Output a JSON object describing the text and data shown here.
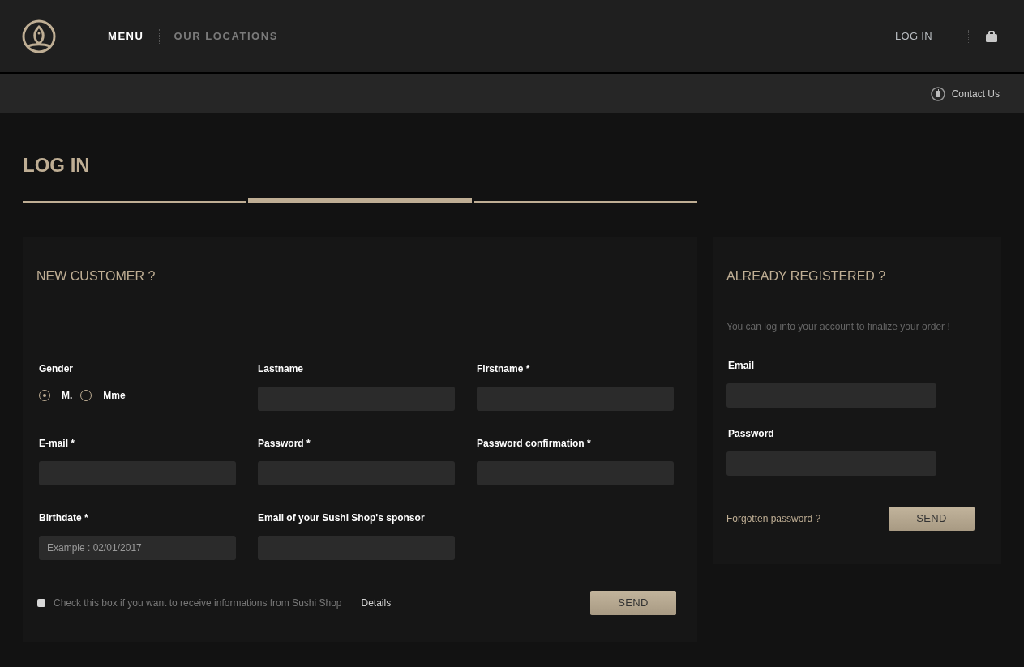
{
  "nav": {
    "items": [
      {
        "label": "MENU",
        "selected": true
      },
      {
        "label": "OUR LOCATIONS",
        "selected": false
      }
    ],
    "login": "LOG IN"
  },
  "subbar": {
    "contact": "Contact Us"
  },
  "page_title": "LOG IN",
  "steps": [
    {
      "selected": false
    },
    {
      "selected": true
    },
    {
      "selected": false
    }
  ],
  "new_customer": {
    "title": "NEW CUSTOMER ?",
    "fields": [
      {
        "kind": "radio",
        "label": "Gender",
        "options": [
          {
            "label": "M.",
            "selected": true
          },
          {
            "label": "Mme",
            "selected": false
          }
        ]
      },
      {
        "kind": "input",
        "label": "Lastname"
      },
      {
        "kind": "input",
        "label": "Firstname *"
      },
      {
        "kind": "input",
        "label": "E-mail *"
      },
      {
        "kind": "input",
        "label": "Password *"
      },
      {
        "kind": "input",
        "label": "Password confirmation *"
      },
      {
        "kind": "input",
        "label": "Birthdate *",
        "placeholder": "Example : 02/01/2017"
      },
      {
        "kind": "input",
        "label": "Email of your Sushi Shop's sponsor"
      }
    ],
    "newsletter": {
      "label": "Check this box if you want to receive informations from Sushi Shop",
      "checked": false
    },
    "details": "Details",
    "send": "SEND"
  },
  "registered": {
    "title": "ALREADY REGISTERED ?",
    "intro": "You can log into your account to finalize your order !",
    "fields": [
      {
        "label": "Email"
      },
      {
        "label": "Password"
      }
    ],
    "forgot": "Forgotten password ?",
    "send": "SEND"
  }
}
